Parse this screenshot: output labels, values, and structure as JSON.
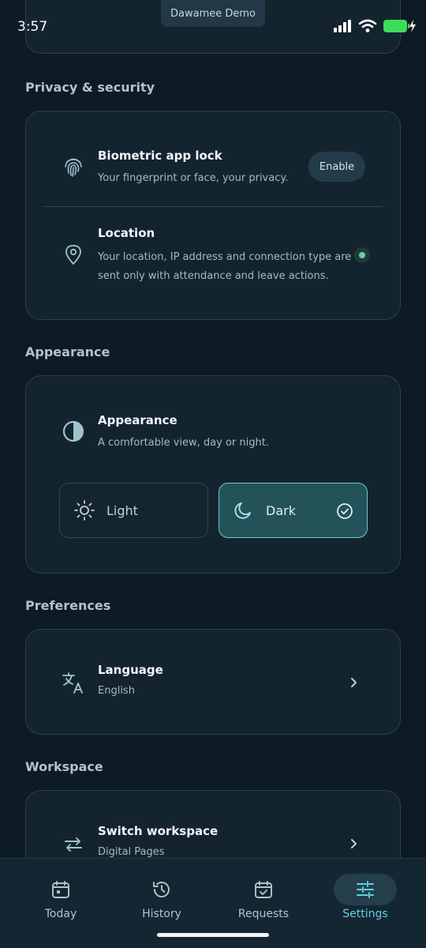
{
  "status_bar": {
    "time": "3:57",
    "demo_label": "Dawamee Demo"
  },
  "sections": {
    "privacy": {
      "title": "Privacy & security",
      "biometric": {
        "title": "Biometric app lock",
        "subtitle": "Your fingerprint or face, your privacy.",
        "icon": "fingerprint-icon",
        "button": "Enable"
      },
      "location": {
        "title": "Location",
        "subtitle": "Your location, IP address and connection type are sent only with attendance and leave actions.",
        "icon": "location-pin-icon"
      }
    },
    "appearance": {
      "title": "Appearance",
      "row": {
        "title": "Appearance",
        "subtitle": "A comfortable view, day or night.",
        "icon": "contrast-icon"
      },
      "options": [
        {
          "label": "Light",
          "icon": "sun-icon",
          "selected": false
        },
        {
          "label": "Dark",
          "icon": "moon-icon",
          "selected": true
        }
      ]
    },
    "preferences": {
      "title": "Preferences",
      "language": {
        "title": "Language",
        "value": "English",
        "icon": "translate-icon"
      }
    },
    "workspace": {
      "title": "Workspace",
      "switch": {
        "title": "Switch workspace",
        "value": "Digital Pages",
        "icon": "swap-arrows-icon"
      }
    }
  },
  "bottom_nav": [
    {
      "label": "Today",
      "icon": "calendar-icon",
      "active": false
    },
    {
      "label": "History",
      "icon": "history-icon",
      "active": false
    },
    {
      "label": "Requests",
      "icon": "calendar-check-icon",
      "active": false
    },
    {
      "label": "Settings",
      "icon": "sliders-icon",
      "active": true
    }
  ],
  "colors": {
    "background": "#0d1b24",
    "card": "#14242f",
    "accent": "#5fd1e0",
    "battery": "#3ddc5a"
  }
}
